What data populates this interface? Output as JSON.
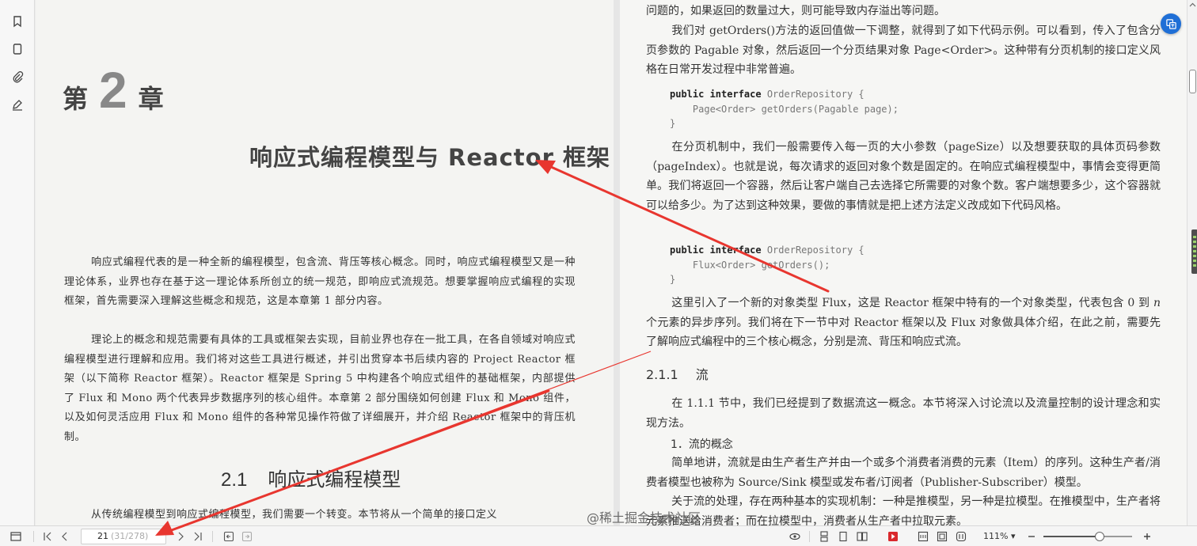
{
  "left_page": {
    "chapter_prefix": "第",
    "chapter_number": "2",
    "chapter_suffix": "章",
    "chapter_title": "响应式编程模型与 Reactor 框架",
    "paragraphs": [
      "响应式编程代表的是一种全新的编程模型，包含流、背压等核心概念。同时，响应式编程模型又是一种理论体系，业界也存在基于这一理论体系所创立的统一规范，即响应式流规范。想要掌握响应式编程的实现框架，首先需要深入理解这些概念和规范，这是本章第 1 部分内容。",
      "理论上的概念和规范需要有具体的工具或框架去实现，目前业界也存在一批工具，在各自领域对响应式编程模型进行理解和应用。我们将对这些工具进行概述，并引出贯穿本书后续内容的 Project Reactor 框架（以下简称 Reactor 框架）。Reactor 框架是 Spring 5 中构建各个响应式组件的基础框架，内部提供了 Flux 和 Mono 两个代表异步数据序列的核心组件。本章第 2 部分围绕如何创建 Flux 和 Mono 组件，以及如何灵活应用 Flux 和 Mono 组件的各种常见操作符做了详细展开，并介绍 Reactor 框架中的背压机制。",
      "从传统编程模型到响应式编程模型，我们需要一个转变。本节将从一个简单的接口定义"
    ],
    "section_number": "2.1",
    "section_title": "响应式编程模型"
  },
  "right_page": {
    "p1": "问题的，如果返回的数量过大，则可能导致内存溢出等问题。",
    "p2": "我们对 getOrders()方法的返回值做一下调整，就得到了如下代码示例。可以看到，传入了包含分页参数的 Pagable 对象，然后返回一个分页结果对象 Page<Order>。这种带有分页机制的接口定义风格在日常开发过程中非常普遍。",
    "code1": {
      "kw": "public interface",
      "name": " OrderRepository {",
      "body": "    Page<Order> getOrders(Pagable page);",
      "close": "}"
    },
    "p3": "在分页机制中，我们一般需要传入每一页的大小参数（pageSize）以及想要获取的具体页码参数（pageIndex）。也就是说，每次请求的返回对象个数是固定的。在响应式编程模型中，事情会变得更简单。我们将返回一个容器，然后让客户端自己去选择它所需要的对象个数。客户端想要多少，这个容器就可以给多少。为了达到这种效果，要做的事情就是把上述方法定义改成如下代码风格。",
    "code2": {
      "kw": "public interface",
      "name": " OrderRepository {",
      "body": "    Flux<Order> getOrders();",
      "close": "}"
    },
    "p4_a": "这里引入了一个新的对象类型 Flux，这是 Reactor 框架中特有的一个对象类型，代表包含 0 到 ",
    "p4_n": "n",
    "p4_b": " 个元素的异步序列。我们将在下一节中对 Reactor 框架以及 Flux 对象做具体介绍，在此之前，需要先了解响应式编程中的三个核心概念，分别是流、背压和响应式流。",
    "subsection_number": "2.1.1",
    "subsection_title": "流",
    "p5": "在 1.1.1 节中，我们已经提到了数据流这一概念。本节将深入讨论流以及流量控制的设计理念和实现方法。",
    "sub_sub_heading": "1．流的概念",
    "p6": "简单地讲，流就是由生产者生产并由一个或多个消费者消费的元素（Item）的序列。这种生产者/消费者模型也被称为 Source/Sink 模型或发布者/订阅者（Publisher-Subscriber）模型。",
    "p7": "关于流的处理，存在两种基本的实现机制：一种是推模型，另一种是拉模型。在推模型中，生产者将元素推送给消费者；而在拉模型中，消费者从生产者中拉取元素。"
  },
  "watermark": "@稀土掘金技术社区",
  "toolbar": {
    "current_page": "21",
    "page_of_total": "(31/278)",
    "zoom": "111%",
    "zoom_caret": "▾",
    "zoom_level": 0.63
  },
  "annotation_color": "#e8362f",
  "accent_color": "#1f6fd6",
  "icons": [
    "bookmark-icon",
    "page-icon",
    "paperclip-icon",
    "sign-icon",
    "sidebar-toggle-icon",
    "first-page-icon",
    "prev-page-icon",
    "next-page-icon",
    "last-page-icon",
    "back-icon",
    "forward-icon",
    "read-mode-icon",
    "continuous-icon",
    "single-page-icon",
    "two-page-icon",
    "play-icon",
    "fit-width-icon",
    "fit-page-icon",
    "actual-size-icon",
    "zoom-out-icon",
    "zoom-in-icon",
    "translate-icon"
  ]
}
